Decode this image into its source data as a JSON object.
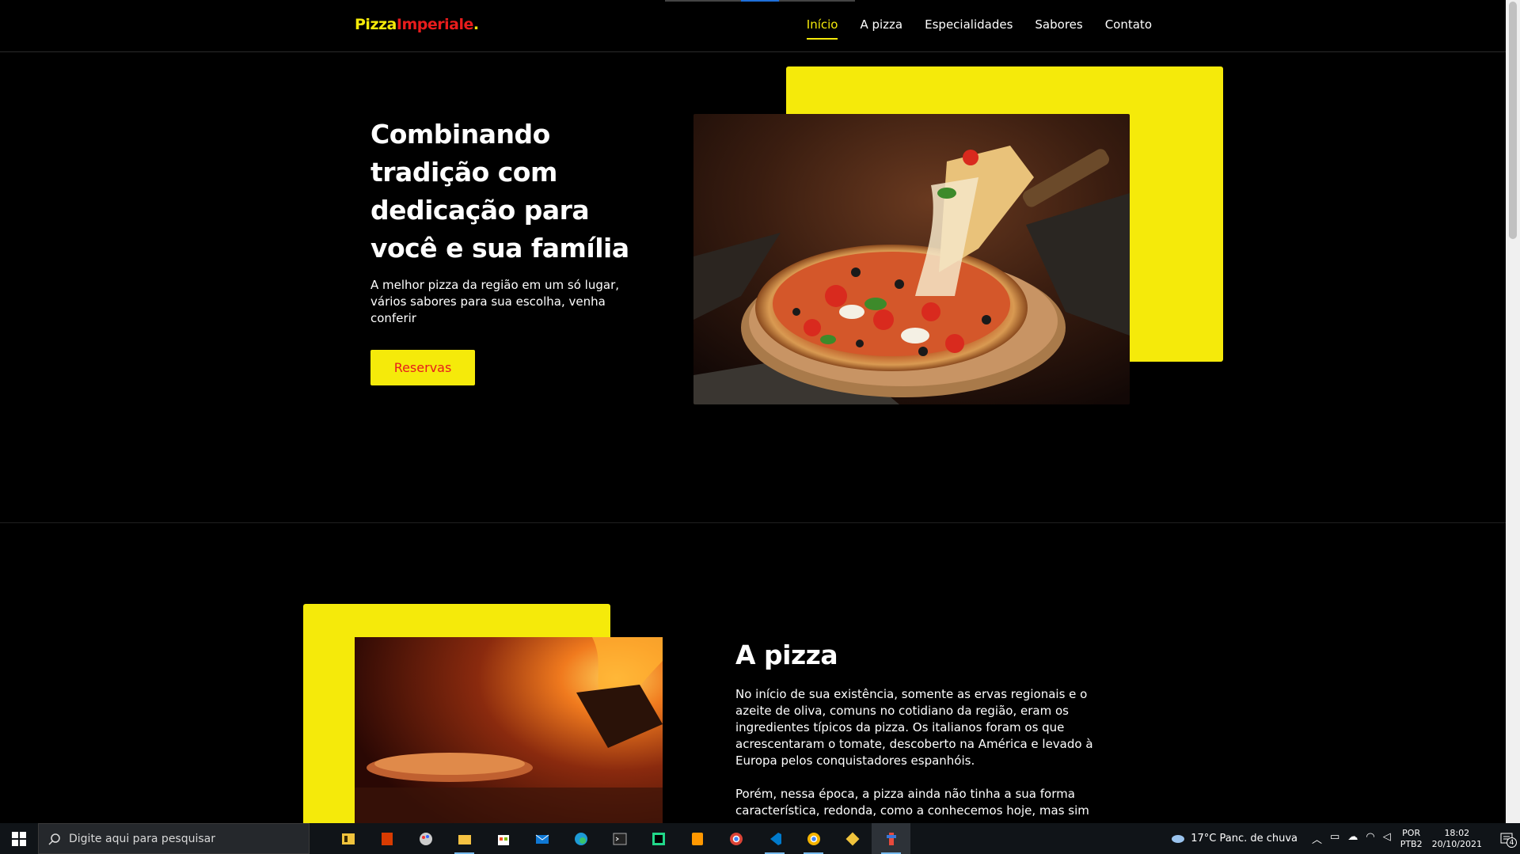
{
  "header": {
    "logo": {
      "part1": "Pizza",
      "part2": "Imperiale",
      "part3": "."
    },
    "nav": [
      {
        "label": "Início",
        "active": true
      },
      {
        "label": "A pizza"
      },
      {
        "label": "Especialidades"
      },
      {
        "label": "Sabores"
      },
      {
        "label": "Contato"
      }
    ]
  },
  "hero": {
    "title": "Combinando tradição com dedicação para você e sua família",
    "subtitle": "A melhor pizza da região em um só lugar, vários sabores para sua escolha, venha conferir",
    "button": "Reservas",
    "image_icon": "pizza-photo"
  },
  "about": {
    "title": "A pizza",
    "p1": "No início de sua existência, somente as ervas regionais e o azeite de oliva, comuns no cotidiano da região, eram os ingredientes típicos da pizza. Os italianos foram os que acrescentaram o tomate, descoberto na América e levado à Europa pelos conquistadores espanhóis.",
    "p2": "Porém, nessa época, a pizza ainda não tinha a sua forma característica, redonda, como a conhecemos hoje, mas sim",
    "image_icon": "oven-fire-photo"
  },
  "colors": {
    "accent": "#f5ea0a",
    "brand_red": "#e81c1c",
    "background": "#000000"
  },
  "taskbar": {
    "search_placeholder": "Digite aqui para pesquisar",
    "apps": [
      "task-view-icon",
      "office-icon",
      "paint-icon",
      "file-explorer-icon",
      "store-icon",
      "mail-icon",
      "edge-icon",
      "terminal-icon",
      "pycharm-icon",
      "sublime-icon",
      "chrome-icon",
      "vscode-icon",
      "chrome-icon",
      "git-icon",
      "app-icon"
    ],
    "weather": "17°C  Panc. de chuva",
    "lang_top": "POR",
    "lang_bottom": "PTB2",
    "time": "18:02",
    "date": "20/10/2021",
    "notifications": "4"
  }
}
